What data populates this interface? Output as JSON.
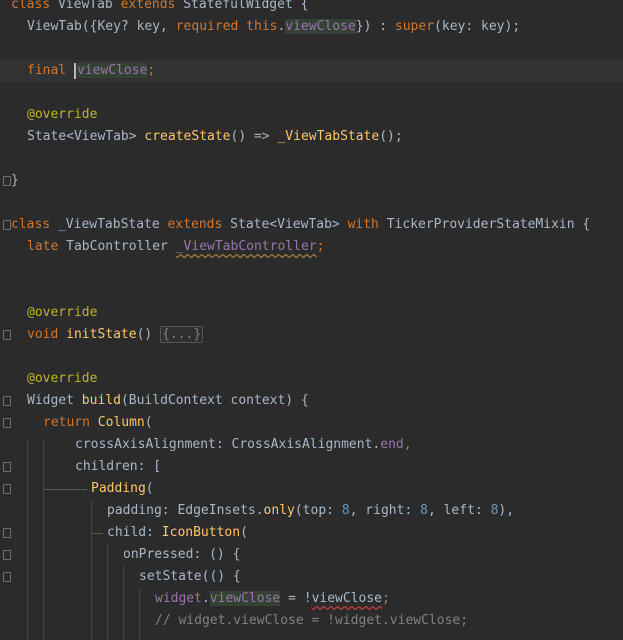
{
  "editor": {
    "lines": {
      "l0": {
        "a": "class ",
        "b": "ViewTab ",
        "c": "extends ",
        "d": "StatefulWidget {"
      },
      "l1": {
        "a": "ViewTab({Key? key, ",
        "b": "required ",
        "c": "this",
        "d": ".",
        "e": "viewClose",
        "f": "}) : ",
        "g": "super",
        "h": "(key: key);"
      },
      "l3": {
        "a": "final ",
        "b": "viewClose",
        "c": ";"
      },
      "l5": {
        "a": "@override"
      },
      "l6": {
        "a": "State<ViewTab> ",
        "b": "createState",
        "c": "() => ",
        "d": "_ViewTabState",
        "e": "();"
      },
      "l8": {
        "a": "}"
      },
      "l10": {
        "a": "class ",
        "b": "_ViewTabState ",
        "c": "extends ",
        "d": "State<ViewTab> ",
        "e": "with ",
        "f": "TickerProviderStateMixin {"
      },
      "l11": {
        "a": "late ",
        "b": "TabController ",
        "c": "_ViewTabController",
        "d": ";"
      },
      "l14": {
        "a": "@override"
      },
      "l15": {
        "a": "void ",
        "b": "initState",
        "c": "() ",
        "d": "{...}"
      },
      "l17": {
        "a": "@override"
      },
      "l18": {
        "a": "Widget ",
        "b": "build",
        "c": "(BuildContext context) {"
      },
      "l19": {
        "a": "return ",
        "b": "Column",
        "c": "("
      },
      "l20": {
        "a": "crossAxisAlignment: CrossAxisAlignment.",
        "b": "end",
        "c": ","
      },
      "l21": {
        "a": "children: ["
      },
      "l22": {
        "a": "Padding",
        "b": "("
      },
      "l23": {
        "a": "padding: ",
        "b": "EdgeInsets.",
        "c": "only",
        "d": "(top: ",
        "e": "8",
        "f": ", right: ",
        "g": "8",
        "h": ", left: ",
        "i": "8",
        "j": "),"
      },
      "l24": {
        "a": "child: ",
        "b": "IconButton",
        "c": "("
      },
      "l25": {
        "a": "onPressed: () {"
      },
      "l26": {
        "a": "setState(() {"
      },
      "l27": {
        "a": "widget",
        "b": ".",
        "c": "viewClose",
        "d": " = !",
        "e": "viewClose",
        "f": ";"
      },
      "l28": {
        "a": "// widget.viewClose = !widget.viewClose;"
      }
    }
  }
}
